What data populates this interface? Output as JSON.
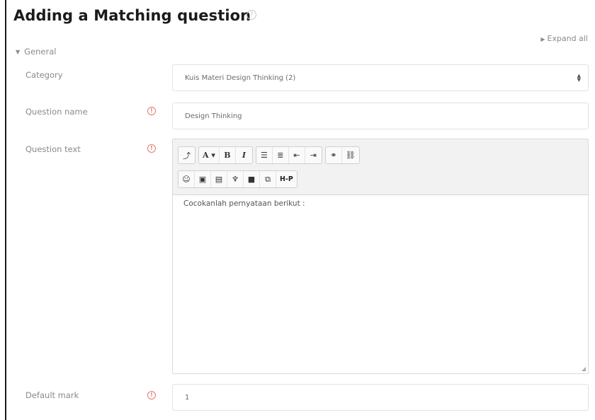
{
  "page": {
    "title": "Adding a Matching question",
    "help_icon": "question-circle-icon",
    "expand_all": "Expand all",
    "section_general": "General"
  },
  "form": {
    "category": {
      "label": "Category",
      "value": "Kuis Materi Design Thinking (2)"
    },
    "question_name": {
      "label": "Question name",
      "value": "Design Thinking",
      "required_icon": "required-exclamation-icon"
    },
    "question_text": {
      "label": "Question text",
      "value": "Cocokanlah pernyataan berikut :",
      "required_icon": "required-exclamation-icon"
    },
    "default_mark": {
      "label": "Default mark",
      "value": "1",
      "required_icon": "required-exclamation-icon"
    }
  },
  "toolbar": {
    "row1": [
      [
        {
          "name": "toolbar-toggle-button",
          "glyph": "⤴"
        }
      ],
      [
        {
          "name": "font-style-button",
          "glyph": "A ▾"
        },
        {
          "name": "bold-button",
          "glyph": "B"
        },
        {
          "name": "italic-button",
          "glyph": "I"
        }
      ],
      [
        {
          "name": "unordered-list-button",
          "glyph": "☰"
        },
        {
          "name": "ordered-list-button",
          "glyph": "≣"
        },
        {
          "name": "outdent-button",
          "glyph": "⇤"
        },
        {
          "name": "indent-button",
          "glyph": "⇥"
        }
      ],
      [
        {
          "name": "link-button",
          "glyph": "🔗"
        },
        {
          "name": "unlink-button",
          "glyph": "⛓"
        }
      ]
    ],
    "row2": [
      [
        {
          "name": "emoticon-button",
          "glyph": "☺"
        },
        {
          "name": "image-button",
          "glyph": "▣"
        },
        {
          "name": "media-button",
          "glyph": "▤"
        },
        {
          "name": "record-audio-button",
          "glyph": "🎙"
        },
        {
          "name": "record-video-button",
          "glyph": "■"
        },
        {
          "name": "manage-files-button",
          "glyph": "⧉"
        },
        {
          "name": "h5p-button",
          "glyph": "H-P"
        }
      ]
    ]
  },
  "colors": {
    "title": "#1b1b1b",
    "label": "#8a8a8a",
    "required": "#e07a6a",
    "toolbar_bg": "#f2f2f2"
  }
}
